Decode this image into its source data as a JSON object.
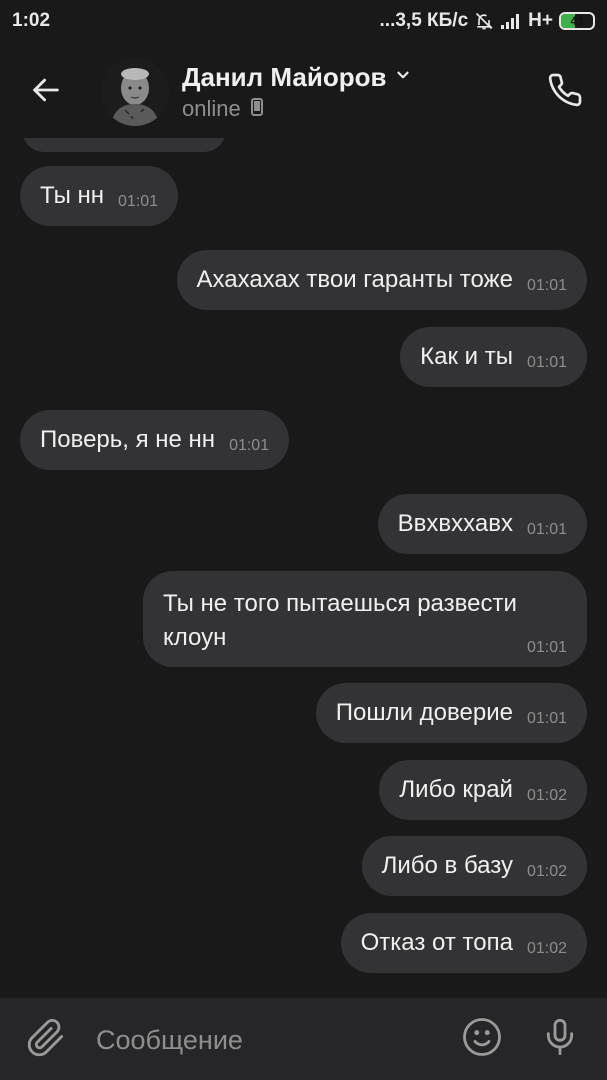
{
  "status_bar": {
    "time": "1:02",
    "network_speed": "...3,5 КБ/с",
    "network_type": "H+",
    "battery": "43",
    "battery_level": 0.43
  },
  "header": {
    "contact_name": "Данил Майоров",
    "status": "online"
  },
  "messages": [
    {
      "text": "Ты нн",
      "time": "01:01",
      "direction": "incoming"
    },
    {
      "text": "Ахахахах твои гаранты тоже",
      "time": "01:01",
      "direction": "outgoing"
    },
    {
      "text": "Как и ты",
      "time": "01:01",
      "direction": "outgoing"
    },
    {
      "text": "Поверь, я не нн",
      "time": "01:01",
      "direction": "incoming"
    },
    {
      "text": "Ввхвххавх",
      "time": "01:01",
      "direction": "outgoing"
    },
    {
      "text": "Ты не того пытаешься развести клоун",
      "time": "01:01",
      "direction": "outgoing"
    },
    {
      "text": "Пошли доверие",
      "time": "01:01",
      "direction": "outgoing"
    },
    {
      "text": "Либо край",
      "time": "01:02",
      "direction": "outgoing"
    },
    {
      "text": "Либо в базу",
      "time": "01:02",
      "direction": "outgoing"
    },
    {
      "text": "Отказ от топа",
      "time": "01:02",
      "direction": "outgoing"
    }
  ],
  "input": {
    "placeholder": "Сообщение",
    "value": ""
  },
  "icons": {
    "back": "arrow-left-icon",
    "call": "phone-icon",
    "attach": "paperclip-icon",
    "emoji": "smiley-icon",
    "mic": "microphone-icon",
    "mobile": "mobile-device-icon",
    "dropdown": "chevron-down-icon"
  },
  "colors": {
    "background": "#19191a",
    "bubble": "#333335",
    "input_bar": "#262628",
    "battery_fill": "#3fb04a"
  }
}
